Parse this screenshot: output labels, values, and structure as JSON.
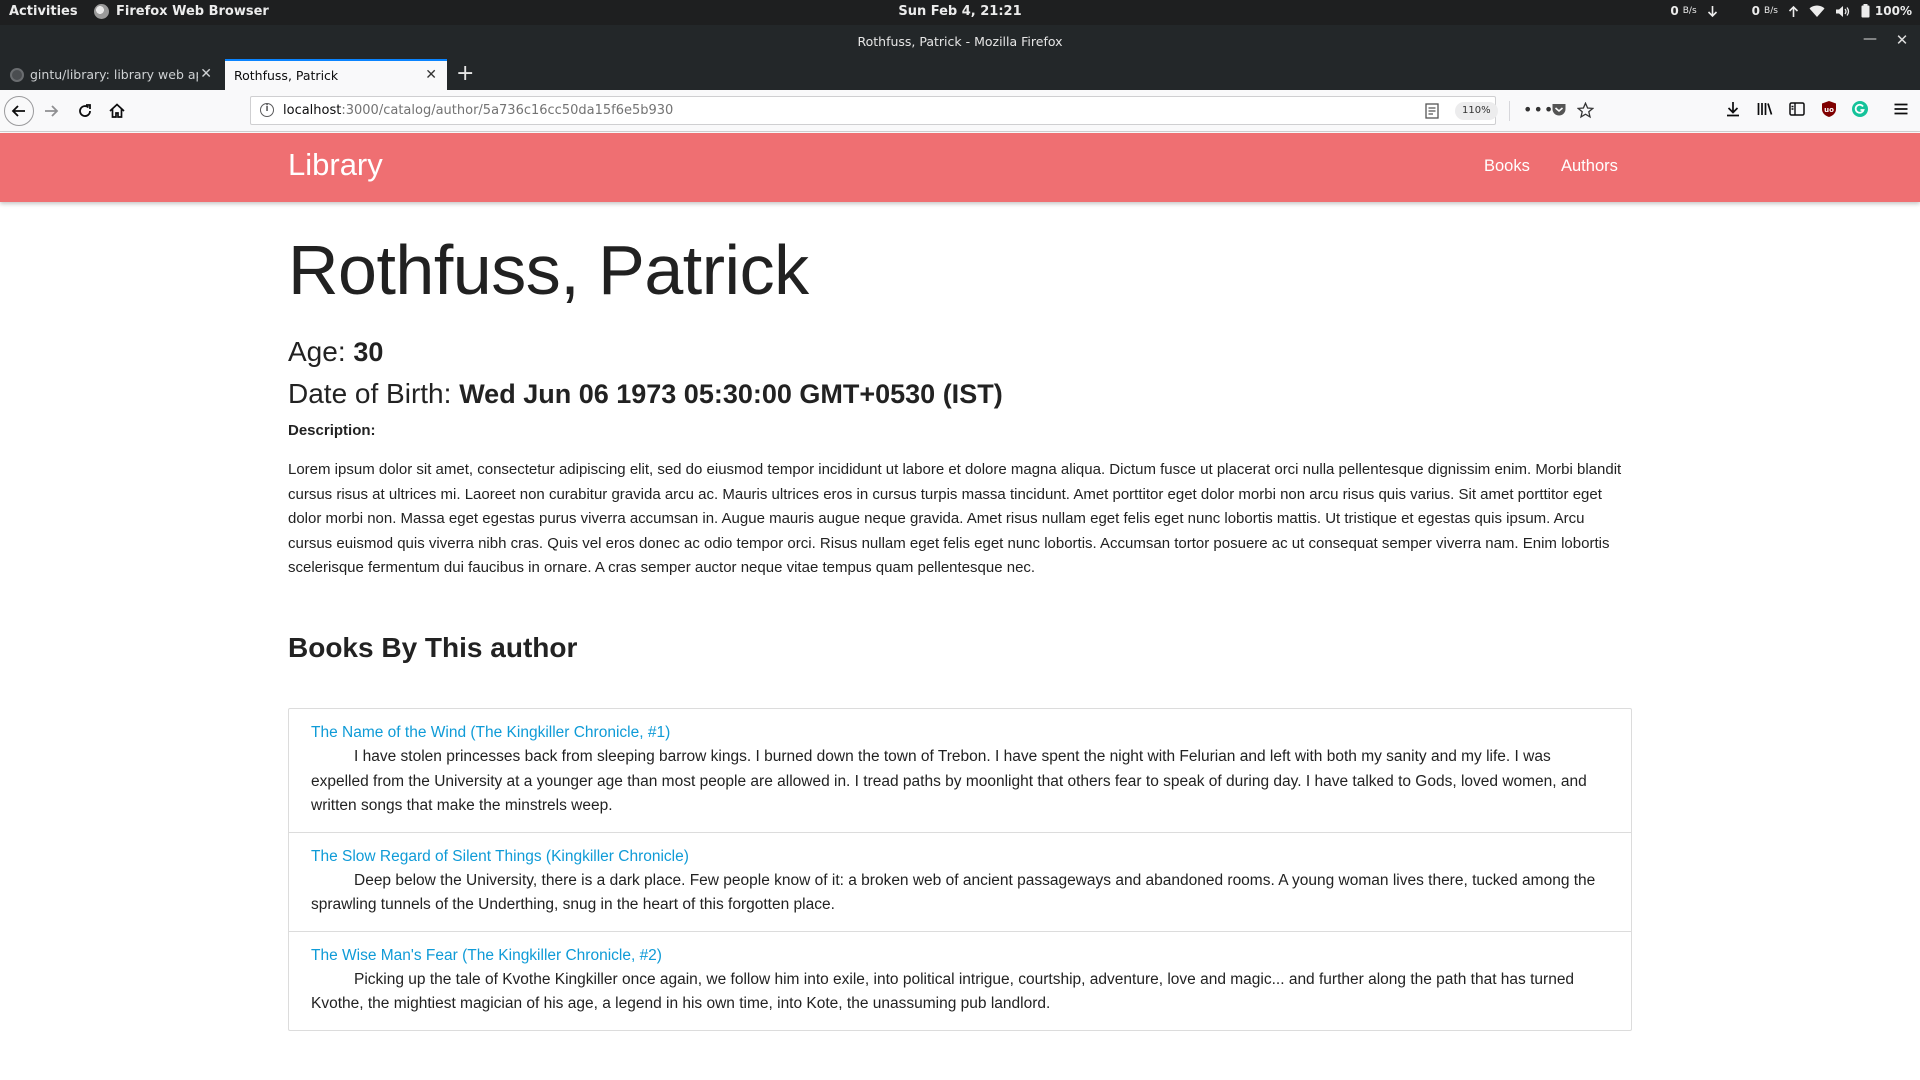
{
  "system_bar": {
    "activities": "Activities",
    "app_name": "Firefox Web Browser",
    "clock": "Sun Feb  4, 21:21",
    "net_down": "0",
    "net_down_unit": "B/s",
    "net_up": "0",
    "net_up_unit": "B/s",
    "battery": "100%"
  },
  "window": {
    "title": "Rothfuss, Patrick - Mozilla Firefox"
  },
  "tabs": [
    {
      "label": "gintu/library: library web ap",
      "active": false
    },
    {
      "label": "Rothfuss, Patrick",
      "active": true
    }
  ],
  "address_bar": {
    "host": "localhost",
    "path": ":3000/catalog/author/5a736c16cc50da15f6e5b930",
    "zoom": "110%"
  },
  "site": {
    "brand": "Library",
    "nav": {
      "books": "Books",
      "authors": "Authors"
    },
    "colors": {
      "navbar": "#ef6f72",
      "link": "#0f9bd7"
    }
  },
  "author": {
    "name": "Rothfuss, Patrick",
    "age_label": "Age: ",
    "age": "30",
    "dob_label": "Date of Birth: ",
    "dob": "Wed Jun 06 1973 05:30:00 GMT+0530 (IST)",
    "description_label": "Description:",
    "description": "Lorem ipsum dolor sit amet, consectetur adipiscing elit, sed do eiusmod tempor incididunt ut labore et dolore magna aliqua. Dictum fusce ut placerat orci nulla pellentesque dignissim enim. Morbi blandit cursus risus at ultrices mi. Laoreet non curabitur gravida arcu ac. Mauris ultrices eros in cursus turpis massa tincidunt. Amet porttitor eget dolor morbi non arcu risus quis varius. Sit amet porttitor eget dolor morbi non. Massa eget egestas purus viverra accumsan in. Augue mauris augue neque gravida. Amet risus nullam eget felis eget nunc lobortis mattis. Ut tristique et egestas quis ipsum. Arcu cursus euismod quis viverra nibh cras. Quis vel eros donec ac odio tempor orci. Risus nullam eget felis eget nunc lobortis. Accumsan tortor posuere ac ut consequat semper viverra nam. Enim lobortis scelerisque fermentum dui faucibus in ornare. A cras semper auctor neque vitae tempus quam pellentesque nec."
  },
  "books_heading": "Books By This author",
  "books": [
    {
      "title": "The Name of the Wind (The Kingkiller Chronicle, #1)",
      "summary": "I have stolen princesses back from sleeping barrow kings. I burned down the town of Trebon. I have spent the night with Felurian and left with both my sanity and my life. I was expelled from the University at a younger age than most people are allowed in. I tread paths by moonlight that others fear to speak of during day. I have talked to Gods, loved women, and written songs that make the minstrels weep."
    },
    {
      "title": "The Slow Regard of Silent Things (Kingkiller Chronicle)",
      "summary": "Deep below the University, there is a dark place. Few people know of it: a broken web of ancient passageways and abandoned rooms. A young woman lives there, tucked among the sprawling tunnels of the Underthing, snug in the heart of this forgotten place."
    },
    {
      "title": "The Wise Man's Fear (The Kingkiller Chronicle, #2)",
      "summary": "Picking up the tale of Kvothe Kingkiller once again, we follow him into exile, into political intrigue, courtship, adventure, love and magic... and further along the path that has turned Kvothe, the mightiest magician of his age, a legend in his own time, into Kote, the unassuming pub landlord."
    }
  ]
}
